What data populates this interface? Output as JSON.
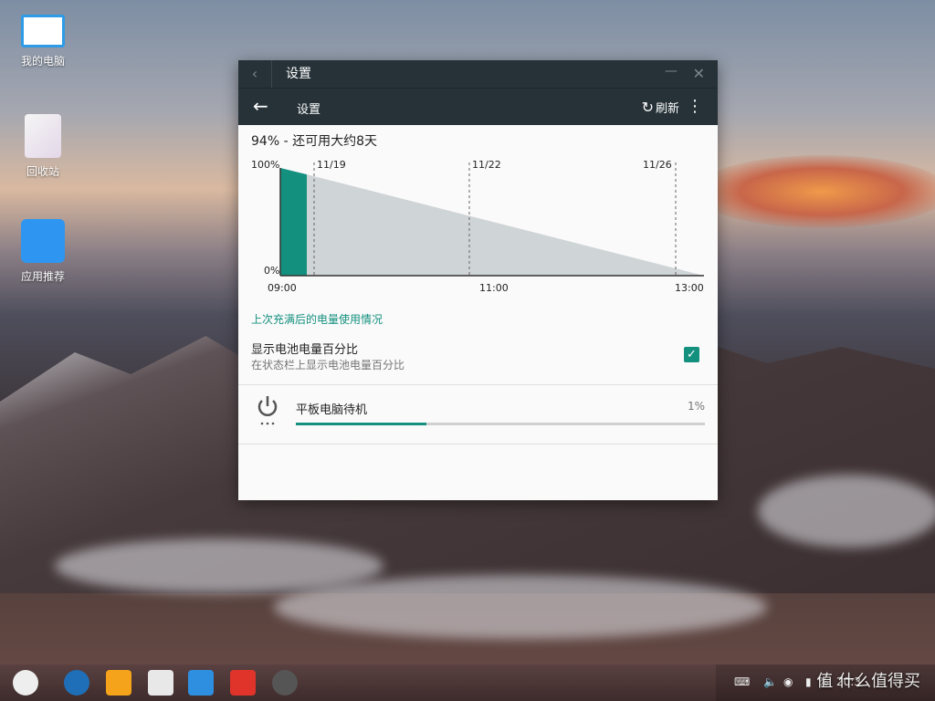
{
  "desktop": {
    "icons": [
      {
        "label": "我的电脑",
        "icon": "computer-icon"
      },
      {
        "label": "回收站",
        "icon": "recycle-bin-icon"
      },
      {
        "label": "应用推荐",
        "icon": "app-store-icon"
      }
    ]
  },
  "window": {
    "title": "设置",
    "toolbar": {
      "title": "设置",
      "refresh_label": "刷新"
    },
    "summary": "94% - 还可用大约8天",
    "chart_data": {
      "type": "area",
      "title": "94% - 还可用大约8天",
      "y_tick_labels": [
        "100%",
        "0%"
      ],
      "ylim": [
        0,
        100
      ],
      "x_tick_labels": [
        "09:00",
        "11:00",
        "13:00"
      ],
      "date_markers": [
        "11/19",
        "11/22",
        "11/26"
      ],
      "series": [
        {
          "values_x": [
            "09:00",
            "09:15"
          ],
          "values": [
            100,
            94
          ],
          "color": "#14907f"
        },
        {
          "values_x": [
            "09:15",
            "13:00"
          ],
          "values": [
            94,
            0
          ],
          "color": "#cfd4d6"
        }
      ]
    },
    "section_header": "上次充满后的电量使用情况",
    "pref": {
      "title": "显示电池电量百分比",
      "subtitle": "在状态栏上显示电池电量百分比",
      "checked": true
    },
    "app_usage": [
      {
        "name": "平板电脑待机",
        "percent": "1%",
        "fraction": 0.32,
        "icon": "power-icon"
      }
    ]
  },
  "taskbar": {
    "apps": [
      "start-menu-icon",
      "browser-icon",
      "file-manager-icon",
      "notes-icon",
      "mail-icon",
      "wps-icon",
      "settings-icon"
    ],
    "clock": "20:3",
    "battery": "%"
  },
  "watermark": "值 什么值得买"
}
